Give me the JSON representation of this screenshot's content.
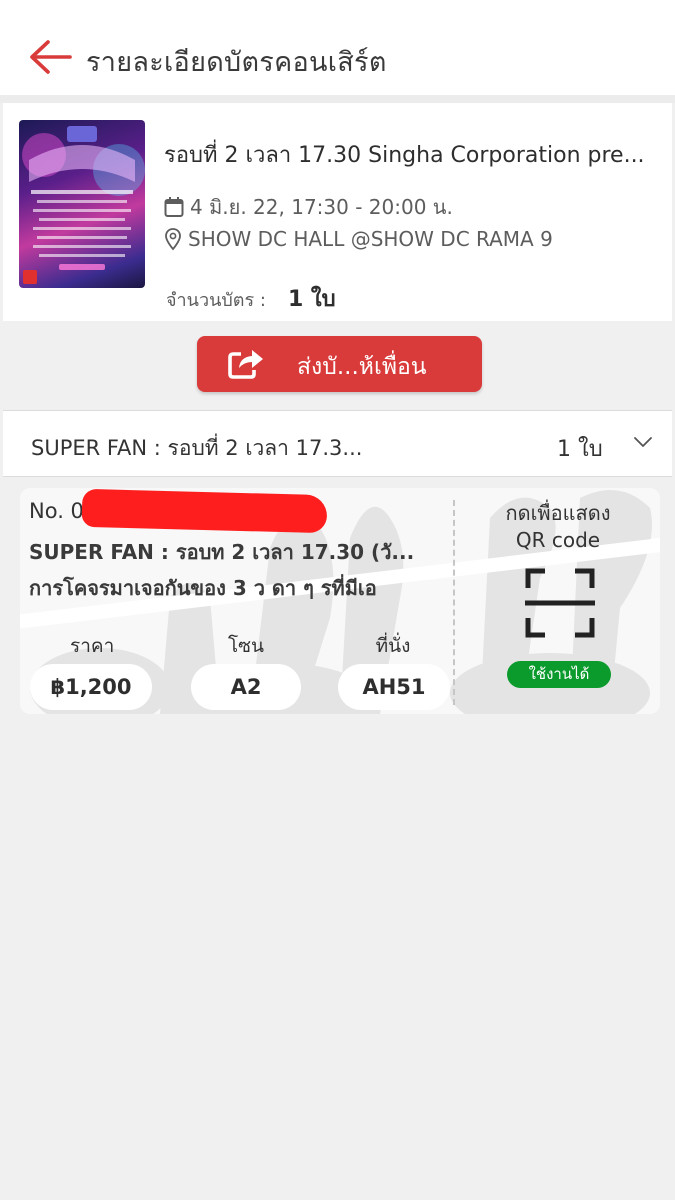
{
  "header": {
    "title": "รายละเอียดบัตรคอนเสิร์ต",
    "back_icon": "arrow-left-icon",
    "accent_color": "#d93a3a"
  },
  "event": {
    "name": "รอบที่ 2 เวลา 17.30 Singha Corporation pre...",
    "date": "4 มิ.ย. 22, 17:30 - 20:00 น.",
    "venue": "SHOW DC HALL @SHOW DC RAMA 9",
    "ticket_count_label": "จำนวนบัตร :",
    "ticket_count_value": "1 ใบ"
  },
  "share_button": {
    "label": "ส่งบั...ห้เพื่อน",
    "icon": "share-icon",
    "color": "#d93a3a"
  },
  "ticket_type": {
    "title": "SUPER FAN : รอบที่ 2 เวลา 17.3...",
    "count": "1 ใบ",
    "icon": "chevron-down-icon"
  },
  "ticket": {
    "number": "No. 02",
    "title": "SUPER FAN : รอบท 2 เวลา 17.30 (วั...",
    "description": "การโคจรมาเจอกันของ 3 ว ดา ๆ รที่มีเอ",
    "price_label": "ราคา",
    "price_value": "฿1,200",
    "zone_label": "โซน",
    "zone_value": "A2",
    "seat_label": "ที่นั่ง",
    "seat_value": "AH51",
    "qr_label": "กดเพื่อแสดง QR code",
    "qr_icon": "qr-scan-icon",
    "status": "ใช้งานได้",
    "status_color": "#0b9a2c"
  }
}
